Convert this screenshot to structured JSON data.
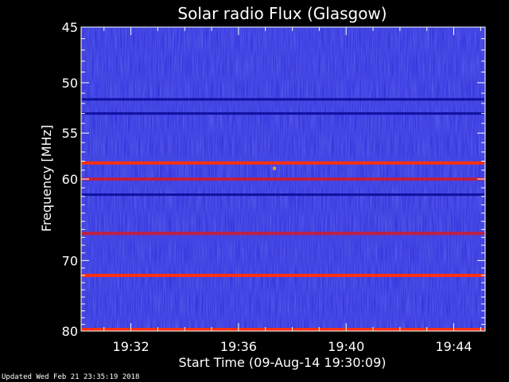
{
  "chart_data": {
    "type": "heatmap",
    "title": "Solar radio Flux (Glasgow)",
    "ylabel": "Frequency [MHz]",
    "xlabel": "Start Time (09-Aug-14 19:30:09)",
    "y_scale": "log",
    "y_inverted": true,
    "ylim": [
      45,
      80
    ],
    "y_ticks_major": [
      45,
      50,
      55,
      60,
      70,
      80
    ],
    "y_ticks_minor": [
      46,
      47,
      48,
      49,
      51,
      52,
      53,
      54,
      56,
      57,
      58,
      59,
      61,
      62,
      63,
      64,
      65,
      66,
      67,
      68,
      69,
      71,
      72,
      73,
      74,
      75,
      76,
      77,
      78,
      79
    ],
    "x_start": "19:30:09",
    "x_end": "19:45:10",
    "x_ticks": [
      "19:32",
      "19:36",
      "19:40",
      "19:44"
    ],
    "x_minor_ticks": [
      "19:31",
      "19:33",
      "19:34",
      "19:35",
      "19:37",
      "19:38",
      "19:39",
      "19:41",
      "19:42",
      "19:43",
      "19:45"
    ],
    "background_color": "#2828d8",
    "horizontal_bands": [
      {
        "freq_mhz": 51.6,
        "intensity": "low"
      },
      {
        "freq_mhz": 53.0,
        "intensity": "low"
      },
      {
        "freq_mhz": 58.2,
        "intensity": "high"
      },
      {
        "freq_mhz": 60.0,
        "intensity": "medium"
      },
      {
        "freq_mhz": 61.8,
        "intensity": "low"
      },
      {
        "freq_mhz": 66.5,
        "intensity": "medium"
      },
      {
        "freq_mhz": 72.0,
        "intensity": "high"
      },
      {
        "freq_mhz": 80.0,
        "intensity": "high"
      }
    ],
    "events": [
      {
        "time": "19:37:20",
        "freq_mhz": 58.8,
        "intensity": "high"
      }
    ]
  },
  "footer": {
    "updated_text": "Updated Wed Feb 21 23:35:19 2018"
  }
}
